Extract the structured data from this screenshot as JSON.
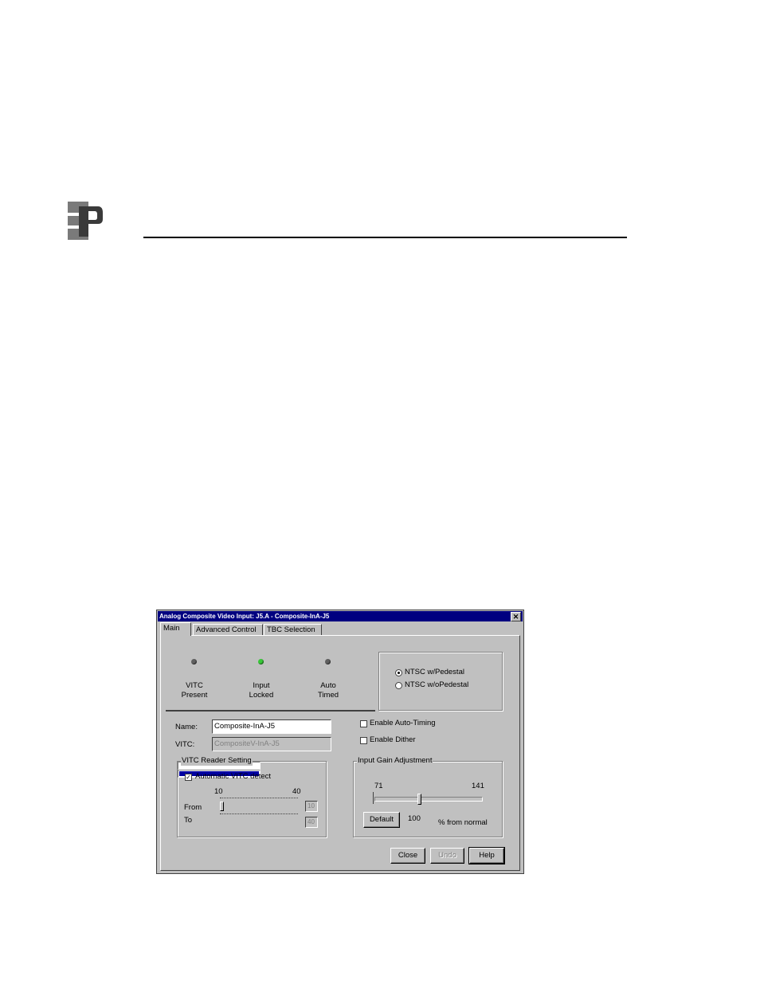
{
  "dialog": {
    "title": "Analog Composite Video Input: J5.A - Composite-InA-J5",
    "close_glyph": "✕",
    "tabs": [
      {
        "label": "Main",
        "active": true
      },
      {
        "label": "Advanced Control",
        "active": false
      },
      {
        "label": "TBC Selection",
        "active": false
      }
    ],
    "indicators": [
      {
        "line1": "VITC",
        "line2": "Present",
        "color": "#606060"
      },
      {
        "line1": "Input",
        "line2": "Locked",
        "color": "#38c838"
      },
      {
        "line1": "Auto",
        "line2": "Timed",
        "color": "#606060"
      }
    ],
    "standard": {
      "options": [
        "NTSC w/Pedestal",
        "NTSC w/oPedestal"
      ],
      "selected": "NTSC w/Pedestal"
    },
    "name_label": "Name:",
    "name_value": "Composite-InA-J5",
    "vitc_label": "VITC:",
    "vitc_value": "CompositeV-InA-J5",
    "enable_auto_timing": {
      "label": "Enable Auto-Timing",
      "checked": false
    },
    "enable_dither": {
      "label": "Enable Dither",
      "checked": false
    },
    "vitc_reader": {
      "title": "VITC Reader Setting",
      "auto_detect": {
        "label": "Automatic VITC detect",
        "checked": true,
        "check_glyph": "✓"
      },
      "scale_min": "10",
      "scale_max": "40",
      "from_label": "From",
      "to_label": "To",
      "from_value": "10",
      "to_value": "40"
    },
    "input_gain": {
      "title": "Input Gain Adjustment",
      "min": "71",
      "max": "141",
      "value": "100",
      "default_label": "Default",
      "units": "% from normal"
    },
    "buttons": {
      "close": "Close",
      "undo": "Undo",
      "help": "Help"
    }
  },
  "colors": {
    "titlebar": "#000080",
    "dialog_face": "#c0c0c0",
    "range_fill": "#0000a0"
  }
}
